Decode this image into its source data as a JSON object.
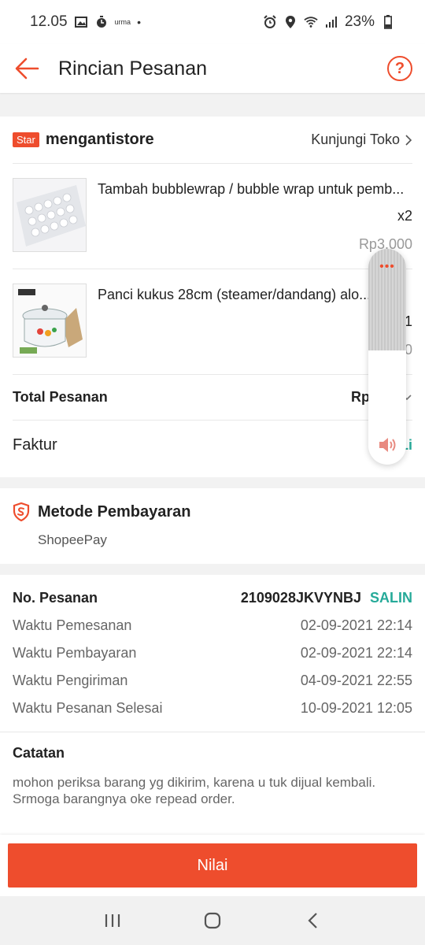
{
  "status_bar": {
    "time": "12.05",
    "carrier_small": "urma",
    "battery": "23%"
  },
  "header": {
    "title": "Rincian Pesanan"
  },
  "shop": {
    "badge": "Star",
    "name": "mengantistore",
    "visit_label": "Kunjungi Toko"
  },
  "products": [
    {
      "name": "Tambah bubblewrap / bubble wrap untuk pemb...",
      "qty": "x2",
      "price": "Rp3.000"
    },
    {
      "name": "Panci kukus 28cm  (steamer/dandang) alo...",
      "qty": "1",
      "price": "Rp1    0"
    }
  ],
  "total": {
    "label": "Total Pesanan",
    "value": "Rp161"
  },
  "invoice": {
    "label": "Faktur",
    "link": "Li"
  },
  "payment": {
    "title": "Metode Pembayaran",
    "method": "ShopeePay"
  },
  "order": {
    "no_label": "No. Pesanan",
    "no_value": "2109028JKVYNBJ",
    "copy_label": "SALIN",
    "rows": [
      {
        "label": "Waktu Pemesanan",
        "value": "02-09-2021 22:14"
      },
      {
        "label": "Waktu Pembayaran",
        "value": "02-09-2021 22:14"
      },
      {
        "label": "Waktu Pengiriman",
        "value": "04-09-2021 22:55"
      },
      {
        "label": "Waktu Pesanan Selesai",
        "value": "10-09-2021 12:05"
      }
    ]
  },
  "note": {
    "title": "Catatan",
    "text": "mohon periksa barang yg dikirim, karena u tuk dijual kembali. Srmoga barangnya oke repead order."
  },
  "action": {
    "button_label": "Nilai"
  },
  "volume": {
    "dots": "•••",
    "level": 0.47
  },
  "colors": {
    "accent": "#ee4d2d",
    "link": "#26aa99"
  },
  "icons": [
    "back-arrow-icon",
    "help-icon",
    "chevron-right-icon",
    "chevron-down-icon",
    "shield-icon",
    "speaker-icon",
    "recents-icon",
    "home-icon",
    "back-nav-icon"
  ]
}
